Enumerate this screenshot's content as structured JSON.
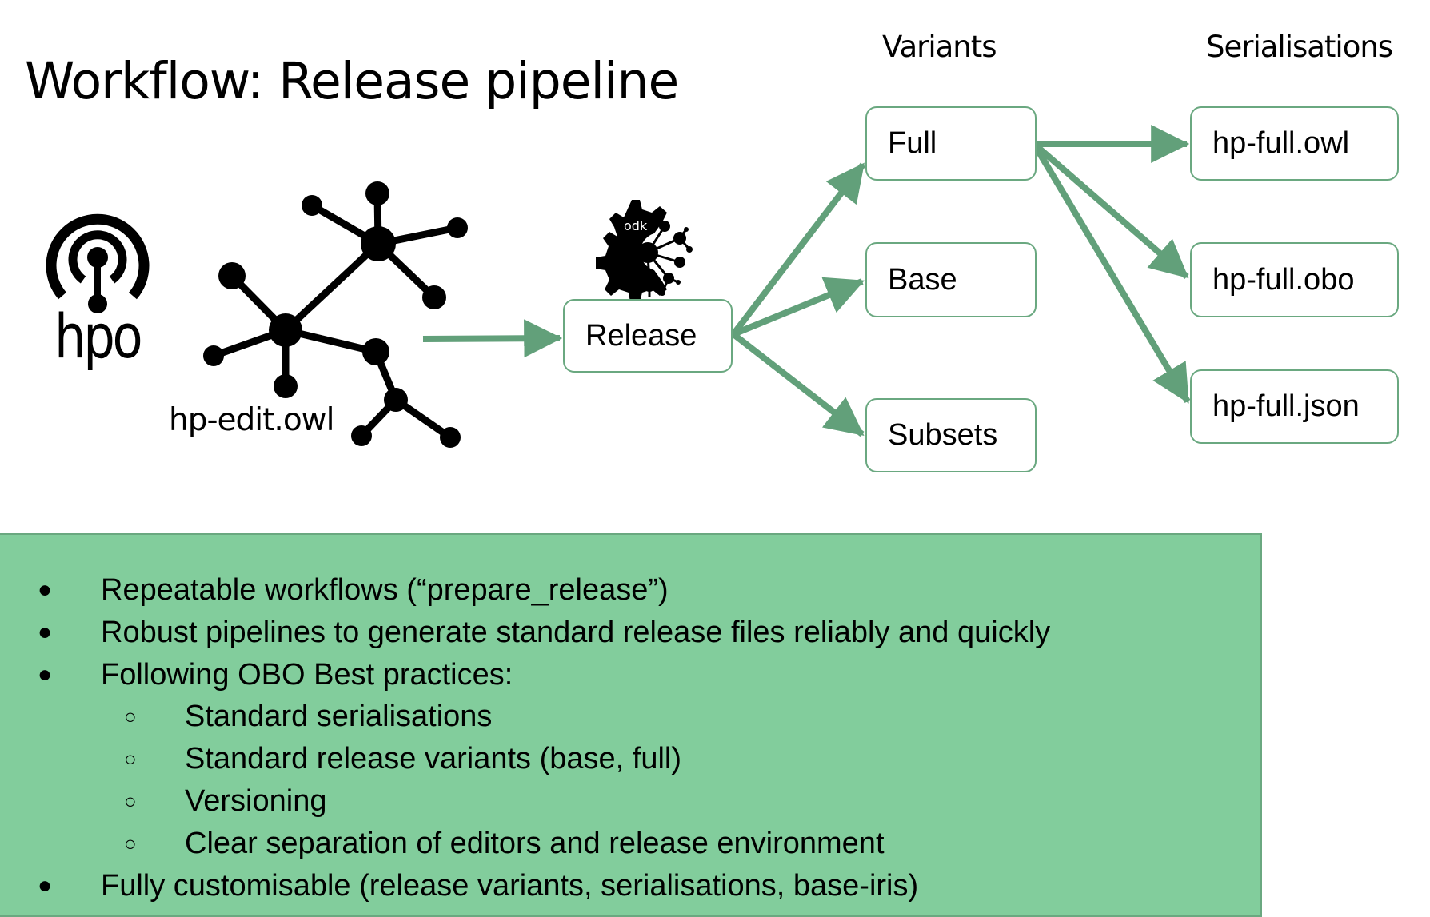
{
  "slide": {
    "title": "Workflow: Release pipeline",
    "columns": {
      "variants_label": "Variants",
      "serialisations_label": "Serialisations"
    }
  },
  "source": {
    "logo_text": "hpo",
    "logo_icon": "hpo-logo-icon",
    "graph_icon": "ontology-graph-icon",
    "file_label": "hp-edit.owl"
  },
  "release": {
    "label": "Release",
    "tool_logo_text": "odk",
    "tool_icon": "odk-gear-icon"
  },
  "variants": [
    {
      "label": "Full"
    },
    {
      "label": "Base"
    },
    {
      "label": "Subsets"
    }
  ],
  "serialisations": [
    {
      "label": "hp-full.owl"
    },
    {
      "label": "hp-full.obo"
    },
    {
      "label": "hp-full.json"
    }
  ],
  "edges": [
    {
      "from": "hp-edit.owl",
      "to": "Release"
    },
    {
      "from": "Release",
      "to": "Full"
    },
    {
      "from": "Release",
      "to": "Base"
    },
    {
      "from": "Release",
      "to": "Subsets"
    },
    {
      "from": "Full",
      "to": "hp-full.owl"
    },
    {
      "from": "Full",
      "to": "hp-full.obo"
    },
    {
      "from": "Full",
      "to": "hp-full.json"
    }
  ],
  "info": {
    "bullets": [
      {
        "level": 1,
        "marker": "●",
        "text": "Repeatable workflows (“prepare_release”)"
      },
      {
        "level": 1,
        "marker": "●",
        "text": "Robust pipelines to generate standard release files reliably and quickly"
      },
      {
        "level": 1,
        "marker": "●",
        "text": "Following OBO Best practices:"
      },
      {
        "level": 2,
        "marker": "○",
        "text": "Standard serialisations"
      },
      {
        "level": 2,
        "marker": "○",
        "text": "Standard release variants (base, full)"
      },
      {
        "level": 2,
        "marker": "○",
        "text": "Versioning"
      },
      {
        "level": 2,
        "marker": "○",
        "text": "Clear separation of editors and release environment"
      },
      {
        "level": 1,
        "marker": "●",
        "text": "Fully customisable (release variants, serialisations, base-iris)"
      }
    ]
  },
  "colors": {
    "accent_green": "#62a07a",
    "box_border": "#6aa880",
    "panel_fill": "#82cd9c",
    "text": "#000000"
  }
}
